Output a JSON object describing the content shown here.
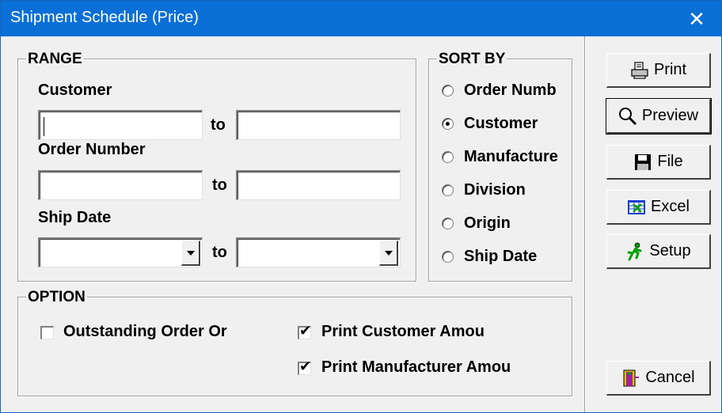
{
  "window": {
    "title": "Shipment Schedule (Price)",
    "close_glyph": "✕"
  },
  "range": {
    "legend": "RANGE",
    "customer_label": "Customer",
    "order_number_label": "Order Number",
    "ship_date_label": "Ship Date",
    "to_label": "to",
    "customer_from": "",
    "customer_to": "",
    "order_from": "",
    "order_to": "",
    "ship_from": "",
    "ship_to": ""
  },
  "sort_by": {
    "legend": "SORT BY",
    "options": [
      {
        "label": "Order Numb",
        "selected": false
      },
      {
        "label": "Customer",
        "selected": true
      },
      {
        "label": "Manufacture",
        "selected": false
      },
      {
        "label": "Division",
        "selected": false
      },
      {
        "label": "Origin",
        "selected": false
      },
      {
        "label": "Ship Date",
        "selected": false
      }
    ]
  },
  "option": {
    "legend": "OPTION",
    "outstanding_label": "Outstanding Order Or",
    "outstanding_checked": false,
    "print_customer_label": "Print Customer Amou",
    "print_customer_checked": true,
    "print_manufacturer_label": "Print Manufacturer Amou",
    "print_manufacturer_checked": true
  },
  "buttons": {
    "print": "Print",
    "preview": "Preview",
    "file": "File",
    "excel": "Excel",
    "setup": "Setup",
    "cancel": "Cancel"
  },
  "icons": {
    "print": "printer-icon",
    "preview": "magnifier-icon",
    "file": "floppy-disk-icon",
    "excel": "spreadsheet-icon",
    "setup": "running-man-icon",
    "cancel": "exit-door-icon"
  },
  "colors": {
    "titlebar": "#0a6fd6",
    "setup_icon": "#00a000",
    "cancel_icon": "#a020a0"
  }
}
